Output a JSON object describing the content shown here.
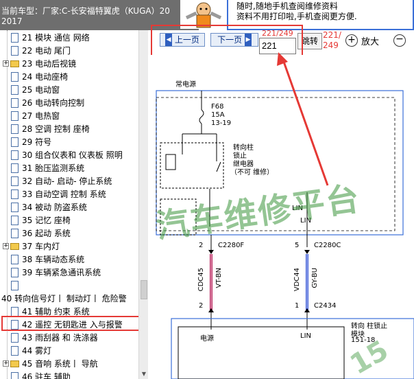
{
  "window": {
    "title_line1": "当前车型：厂家:C-长安福特翼虎（KUGA）20",
    "title_line2": "2017"
  },
  "banner": {
    "line1": "随时,随地手机查阅维修资料",
    "line2": "资料不用打印啦,手机查阅更方便."
  },
  "toolbar": {
    "prev_label": "上一页",
    "next_label": "下一页",
    "page_value": "221",
    "page_above_input": "221/249",
    "jump_label": "跳转",
    "page_count_line1": "221/",
    "page_count_line2": "249",
    "zoom_label": "放大"
  },
  "tree": {
    "items": [
      {
        "label": "21 模块 通信 网络",
        "type": "doc"
      },
      {
        "label": "22 电动 尾门",
        "type": "doc"
      },
      {
        "label": "23 电动后视镜",
        "type": "folder"
      },
      {
        "label": "24 电动座椅",
        "type": "doc"
      },
      {
        "label": "25 电动窗",
        "type": "doc"
      },
      {
        "label": "26 电动转向控制",
        "type": "doc"
      },
      {
        "label": "27 电热窗",
        "type": "doc"
      },
      {
        "label": "28 空调 控制 座椅",
        "type": "doc"
      },
      {
        "label": "29 符号",
        "type": "doc"
      },
      {
        "label": "30 组合仪表和 仪表板 照明",
        "type": "doc"
      },
      {
        "label": "31 胎压监测系统",
        "type": "doc"
      },
      {
        "label": "32 自动- 启动- 停止系统",
        "type": "doc"
      },
      {
        "label": "33 自动空调 控制 系统",
        "type": "doc"
      },
      {
        "label": "34 被动 防盗系统",
        "type": "doc"
      },
      {
        "label": "35 记忆 座椅",
        "type": "doc"
      },
      {
        "label": "36 起动 系统",
        "type": "doc"
      },
      {
        "label": "37 车内灯",
        "type": "folder"
      },
      {
        "label": "38 车辆动态系统",
        "type": "doc"
      },
      {
        "label": "39 车辆紧急通讯系统",
        "type": "doc"
      },
      {
        "label": "",
        "type": "doc"
      },
      {
        "label": "40 转向信号灯丨 制动灯丨 危险警",
        "type": "plain"
      },
      {
        "label": "41 辅助 约束 系统",
        "type": "doc"
      },
      {
        "label": "42 遥控 无钥匙进 入与报警",
        "type": "doc",
        "selected": true
      },
      {
        "label": "43 雨刮器 和 洗涤器",
        "type": "doc"
      },
      {
        "label": "44 雾灯",
        "type": "doc"
      },
      {
        "label": "45 音响 系统丨 导航",
        "type": "folder"
      },
      {
        "label": "46 驻车 辅助",
        "type": "doc"
      }
    ]
  },
  "diagram": {
    "power_label": "常电源",
    "fuse_id": "F68",
    "fuse_amp": "15A",
    "fuse_pos": "13-19",
    "relay_title1": "转向柱",
    "relay_title2": "锁止",
    "relay_title3": "继电器",
    "relay_title4": "（不可 维修）",
    "pin_left_top": "2",
    "conn_left": "C2280F",
    "pin_right_top": "5",
    "conn_right": "C2280C",
    "lin_label": "LIN",
    "lin_prefix": "LIN",
    "wire_left_circuit": "CDC45",
    "wire_left_color": "VT-BN",
    "wire_right_circuit": "VDC44",
    "wire_right_color": "GY-BU",
    "pin_left_bottom": "2",
    "pin_right_bottom": "1",
    "conn_bottom": "C2434",
    "module_title1": "转向 柱锁止",
    "module_title2": "模块",
    "module_ref": "151-18",
    "module_power": "电源",
    "module_lin": "LIN",
    "watermark": "汽车维修平台",
    "watermark_small": "15"
  },
  "colors": {
    "title_bg": "#6e6e6e",
    "accent_blue": "#3a6fd8",
    "annotation_red": "#e53935",
    "watermark_green": "#3c963c",
    "wire_left": "#b7255e",
    "wire_right": "#3d5bd8"
  }
}
